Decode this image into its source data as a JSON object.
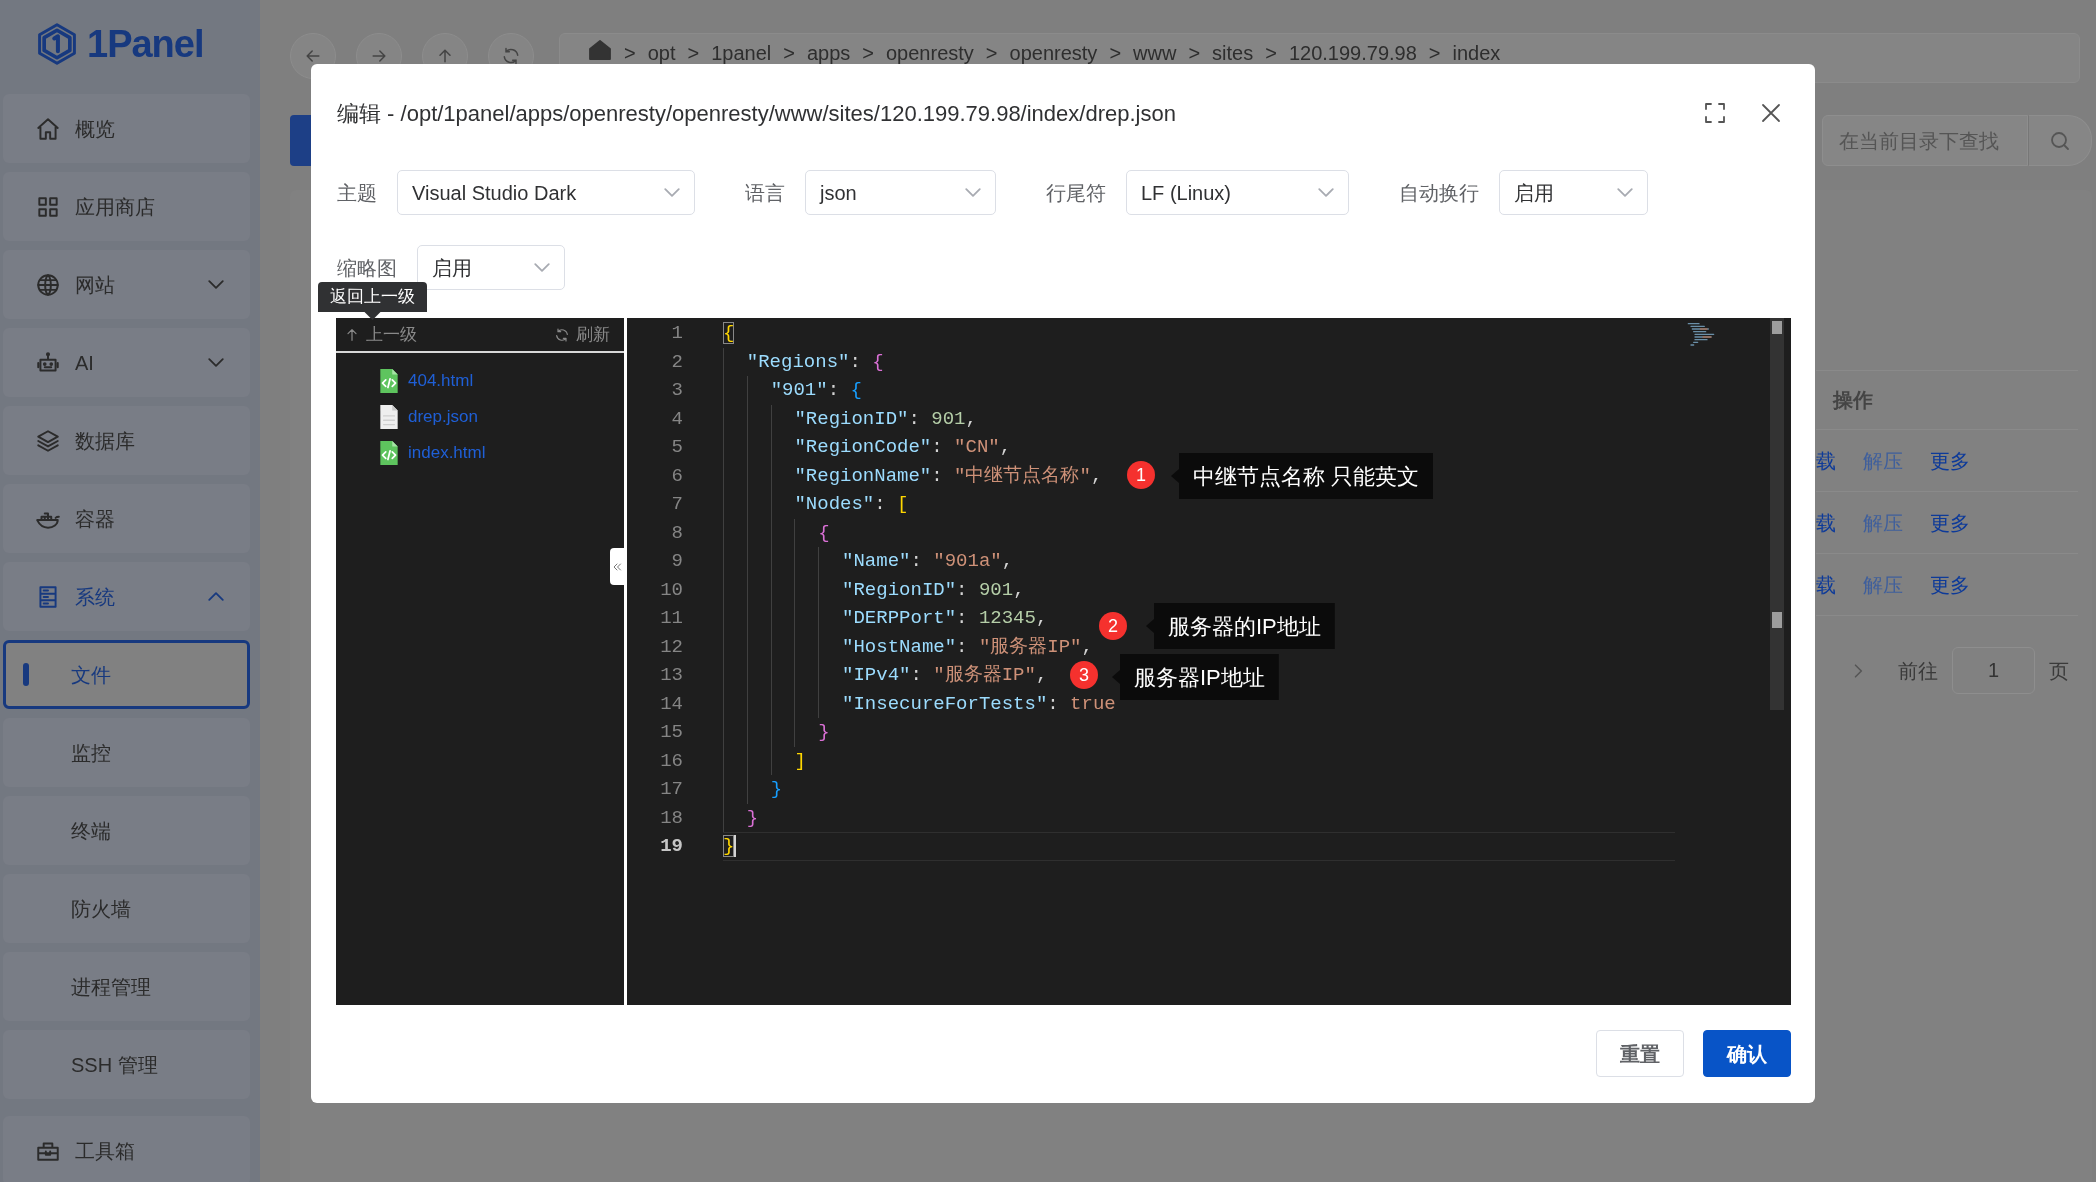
{
  "sidebar": {
    "logo": "1Panel",
    "items": [
      {
        "label": "概览",
        "selected": false
      },
      {
        "label": "应用商店",
        "selected": false
      },
      {
        "label": "网站",
        "selected": false,
        "expanded": false
      },
      {
        "label": "AI",
        "selected": false,
        "expanded": false
      },
      {
        "label": "数据库",
        "selected": false
      },
      {
        "label": "容器",
        "selected": false
      },
      {
        "label": "系统",
        "selected": true,
        "expanded": true,
        "children": [
          {
            "label": "文件",
            "selected": true
          },
          {
            "label": "监控",
            "selected": false
          },
          {
            "label": "终端",
            "selected": false
          },
          {
            "label": "防火墙",
            "selected": false
          },
          {
            "label": "进程管理",
            "selected": false
          },
          {
            "label": "SSH 管理",
            "selected": false
          }
        ]
      },
      {
        "label": "工具箱",
        "selected": false
      }
    ]
  },
  "background": {
    "breadcrumb": {
      "separator": ">",
      "parts": [
        "opt",
        "1panel",
        "apps",
        "openresty",
        "openresty",
        "www",
        "sites",
        "120.199.79.98",
        "index"
      ]
    },
    "search": {
      "placeholder": "在当前目录下查找"
    },
    "table": {
      "column": "操作",
      "rows": [
        [
          {
            "label": "载",
            "disabled": false
          },
          {
            "label": "解压",
            "disabled": true
          },
          {
            "label": "更多",
            "disabled": false
          }
        ],
        [
          {
            "label": "载",
            "disabled": false
          },
          {
            "label": "解压",
            "disabled": true
          },
          {
            "label": "更多",
            "disabled": false
          }
        ],
        [
          {
            "label": "载",
            "disabled": false
          },
          {
            "label": "解压",
            "disabled": true
          },
          {
            "label": "更多",
            "disabled": false
          }
        ]
      ]
    },
    "pagination": {
      "prefix": "前往",
      "page": "1",
      "suffix": "页"
    }
  },
  "dialog": {
    "title": "编辑 - /opt/1panel/apps/openresty/openresty/www/sites/120.199.79.98/index/drep.json",
    "options": [
      {
        "label": "主题",
        "value": "Visual Studio Dark"
      },
      {
        "label": "语言",
        "value": "json"
      },
      {
        "label": "行尾符",
        "value": "LF (Linux)"
      },
      {
        "label": "自动换行",
        "value": "启用"
      },
      {
        "label": "缩略图",
        "value": "启用"
      }
    ],
    "tooltip": "返回上一级",
    "file_tree": {
      "up": "上一级",
      "refresh": "刷新",
      "files": [
        {
          "name": "404.html",
          "kind": "html"
        },
        {
          "name": "drep.json",
          "kind": "text"
        },
        {
          "name": "index.html",
          "kind": "html"
        }
      ]
    },
    "editor": {
      "lines": [
        {
          "number": "1",
          "current": false,
          "text": "{"
        },
        {
          "number": "2",
          "current": false,
          "text": "  \"Regions\": {"
        },
        {
          "number": "3",
          "current": false,
          "text": "    \"901\": {"
        },
        {
          "number": "4",
          "current": false,
          "text": "      \"RegionID\": 901,"
        },
        {
          "number": "5",
          "current": false,
          "text": "      \"RegionCode\": \"CN\","
        },
        {
          "number": "6",
          "current": false,
          "text": "      \"RegionName\": \"中继节点名称\","
        },
        {
          "number": "7",
          "current": false,
          "text": "      \"Nodes\": ["
        },
        {
          "number": "8",
          "current": false,
          "text": "        {"
        },
        {
          "number": "9",
          "current": false,
          "text": "          \"Name\": \"901a\","
        },
        {
          "number": "10",
          "current": false,
          "text": "          \"RegionID\": 901,"
        },
        {
          "number": "11",
          "current": false,
          "text": "          \"DERPPort\": 12345,"
        },
        {
          "number": "12",
          "current": false,
          "text": "          \"HostName\": \"服务器IP\","
        },
        {
          "number": "13",
          "current": false,
          "text": "          \"IPv4\": \"服务器IP\","
        },
        {
          "number": "14",
          "current": false,
          "text": "          \"InsecureForTests\": true"
        },
        {
          "number": "15",
          "current": false,
          "text": "        }"
        },
        {
          "number": "16",
          "current": false,
          "text": "      ]"
        },
        {
          "number": "17",
          "current": false,
          "text": "    }"
        },
        {
          "number": "18",
          "current": false,
          "text": "  }"
        },
        {
          "number": "19",
          "current": true,
          "text": "}"
        }
      ],
      "annotations": [
        {
          "number": "1",
          "text": "中继节点名称 只能英文"
        },
        {
          "number": "2",
          "text": "服务器的IP地址"
        },
        {
          "number": "3",
          "text": "服务器IP地址"
        }
      ]
    },
    "buttons": [
      {
        "label": "重置",
        "kind": "secondary"
      },
      {
        "label": "确认",
        "kind": "primary"
      }
    ]
  }
}
